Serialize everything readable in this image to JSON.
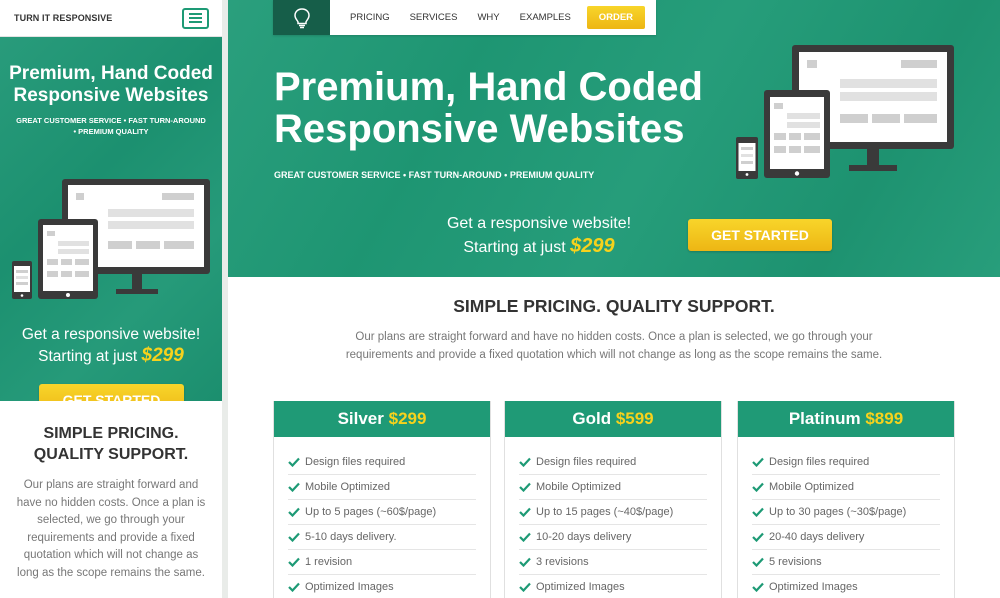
{
  "mobile": {
    "brand": "TURN IT RESPONSIVE",
    "menu_icon": "hamburger-menu-icon",
    "hero": {
      "title_line1": "Premium, Hand Coded",
      "title_line2": "Responsive Websites",
      "subtitle_line1": "GREAT CUSTOMER SERVICE • FAST TURN-AROUND",
      "subtitle_line2": "• PREMIUM QUALITY",
      "cta_line1": "Get a responsive website!",
      "cta_prefix": "Starting at just",
      "cta_price": "$299",
      "button_label": "GET STARTED"
    },
    "pricing": {
      "title_line1": "SIMPLE PRICING.",
      "title_line2": "QUALITY SUPPORT.",
      "text": "Our plans are straight forward and have no hidden costs. Once a plan is selected, we go through your requirements and provide a fixed quotation which will not change as long as the scope remains the same."
    }
  },
  "desktop": {
    "logo_icon": "lightbulb-icon",
    "nav": [
      "PRICING",
      "SERVICES",
      "WHY",
      "EXAMPLES"
    ],
    "nav_order": "ORDER",
    "hero": {
      "title_line1": "Premium, Hand Coded",
      "title_line2": "Responsive Websites",
      "subtitle": "GREAT CUSTOMER SERVICE • FAST TURN-AROUND • PREMIUM QUALITY",
      "cta_line1": "Get a responsive website!",
      "cta_prefix": "Starting at just",
      "cta_price": "$299",
      "button_label": "GET STARTED"
    },
    "pricing": {
      "title": "SIMPLE PRICING. QUALITY SUPPORT.",
      "text": "Our plans are straight forward and have no hidden costs. Once a plan is selected, we go through your requirements and provide a fixed quotation which will not change as long as the scope remains the same."
    },
    "plans": [
      {
        "name": "Silver",
        "price": "$299",
        "features": [
          "Design files required",
          "Mobile Optimized",
          "Up to 5 pages (~60$/page)",
          "5-10 days delivery.",
          "1 revision",
          "Optimized Images"
        ]
      },
      {
        "name": "Gold",
        "price": "$599",
        "features": [
          "Design files required",
          "Mobile Optimized",
          "Up to 15 pages (~40$/page)",
          "10-20 days delivery",
          "3 revisions",
          "Optimized Images"
        ]
      },
      {
        "name": "Platinum",
        "price": "$899",
        "features": [
          "Design files required",
          "Mobile Optimized",
          "Up to 30 pages (~30$/page)",
          "20-40 days delivery",
          "5 revisions",
          "Optimized Images"
        ]
      }
    ]
  },
  "colors": {
    "brand_green": "#1f9a76",
    "dark_green": "#165e49",
    "accent_yellow": "#f7d21c",
    "check_green": "#1d9a75"
  }
}
